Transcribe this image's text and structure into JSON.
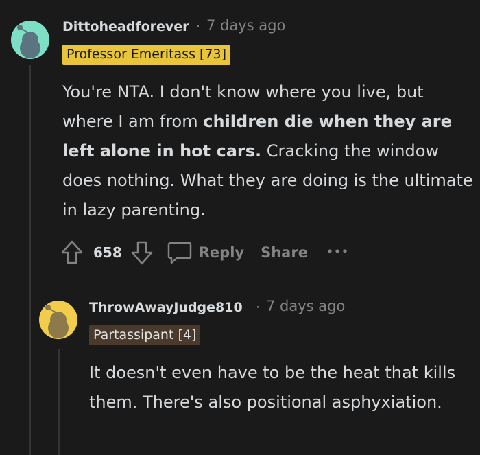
{
  "comments": [
    {
      "username": "Dittoheadforever",
      "separator": "·",
      "time": "7 days ago",
      "flair": "Professor Emeritass [73]",
      "body": {
        "part1": "You're NTA. I don't know where you live, but where I am from ",
        "bold": "children die when they are left alone in hot cars.",
        "part2": " Cracking the window does nothing. What they are doing is the ultimate in lazy parenting."
      },
      "score": "658",
      "reply_label": "Reply",
      "share_label": "Share",
      "colors": {
        "avatar": "#7ddfc3",
        "flair_bg": "#e8c53a",
        "flair_text": "#1a1a1b"
      }
    },
    {
      "username": "ThrowAwayJudge810",
      "separator": "·",
      "time": "7 days ago",
      "flair": "Partassipant [4]",
      "body": {
        "part1": "It doesn't even have to be the heat that kills them. There's also positional asphyxiation."
      },
      "colors": {
        "avatar": "#f2cd4b",
        "flair_bg": "#4a3a2c",
        "flair_text": "#e3e3e3"
      }
    }
  ]
}
